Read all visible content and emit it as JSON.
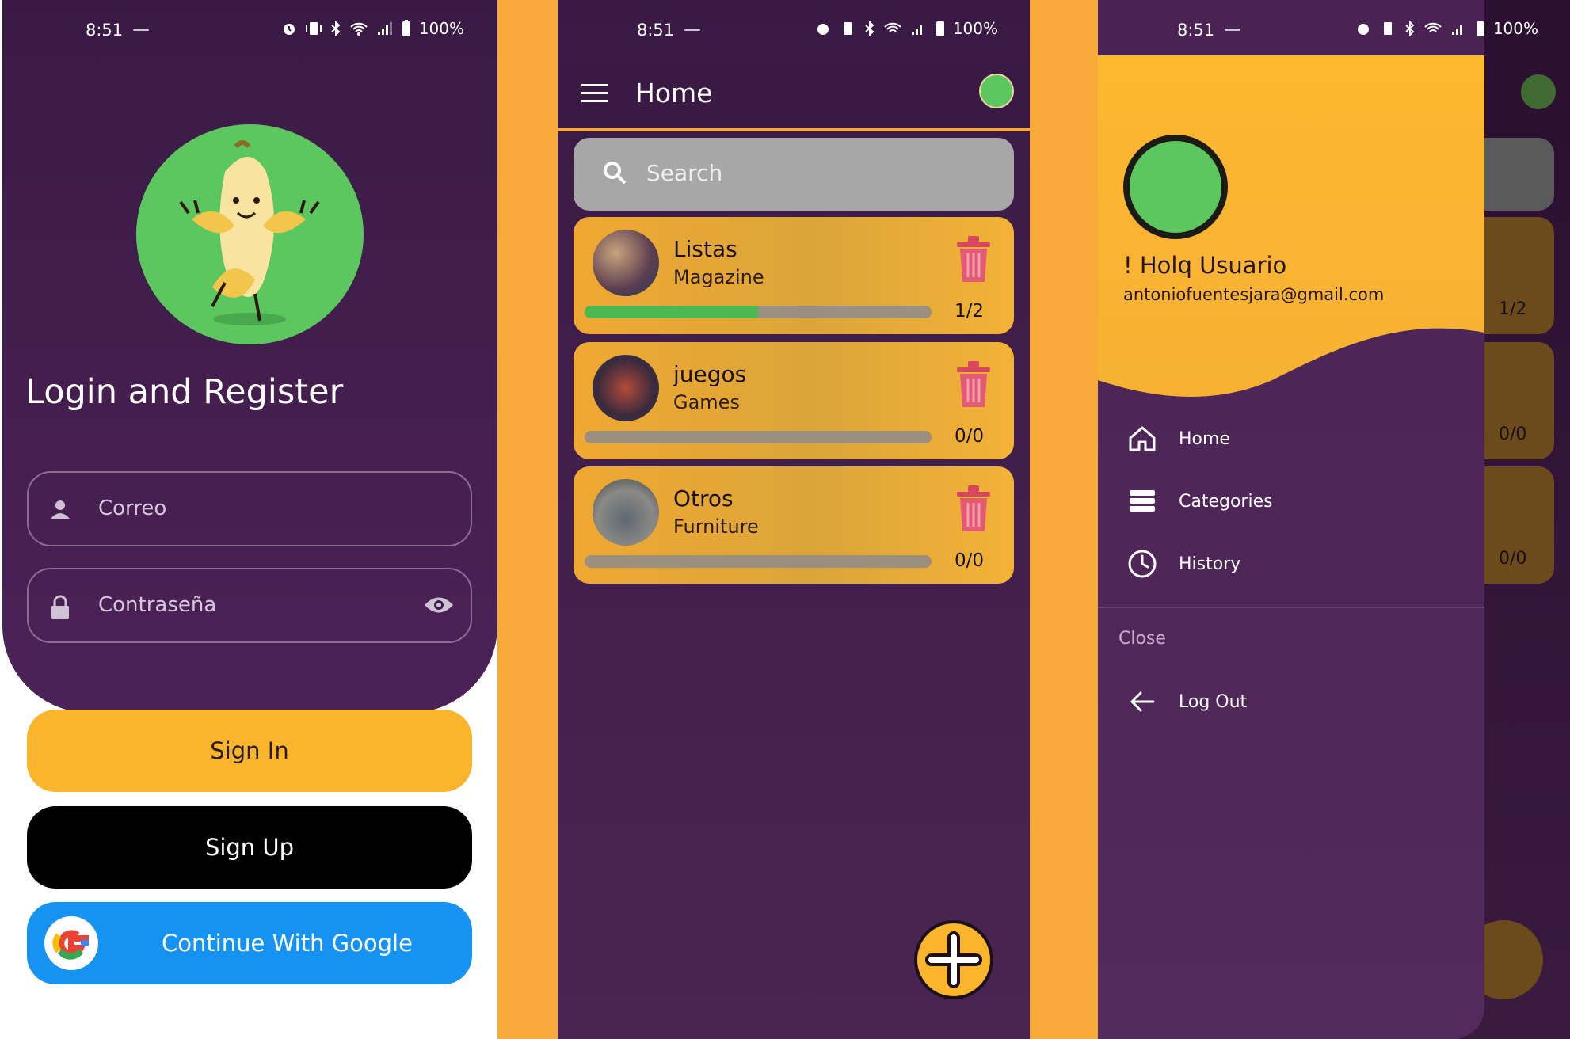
{
  "status_bar": {
    "time": "8:51",
    "battery": "100%"
  },
  "login": {
    "title": "Login and Register",
    "email_placeholder": "Correo",
    "password_placeholder": "Contraseña",
    "sign_in_label": "Sign In",
    "sign_up_label": "Sign Up",
    "google_label": "Continue With Google"
  },
  "home": {
    "title": "Home",
    "search_placeholder": "Search",
    "lists": [
      {
        "title": "Listas",
        "category": "Magazine",
        "count": "1/2",
        "progress": 0.5
      },
      {
        "title": "juegos",
        "category": "Games",
        "count": "0/0",
        "progress": 0
      },
      {
        "title": "Otros",
        "category": "Furniture",
        "count": "0/0",
        "progress": 0
      }
    ]
  },
  "drawer": {
    "greeting": "! Holq Usuario",
    "email": "antoniofuentesjara@gmail.com",
    "items": [
      {
        "label": "Home",
        "icon": "home-icon"
      },
      {
        "label": "Categories",
        "icon": "categories-icon"
      },
      {
        "label": "History",
        "icon": "history-icon"
      }
    ],
    "section_label": "Close",
    "logout_label": "Log Out",
    "behind_counts": [
      "1/2",
      "0/0",
      "0/0"
    ]
  },
  "colors": {
    "purple_dark": "#3a1a45",
    "accent_orange": "#f7a93a",
    "button_yellow": "#fbb52d",
    "google_blue": "#1592f2",
    "logo_green": "#5cc75e"
  }
}
